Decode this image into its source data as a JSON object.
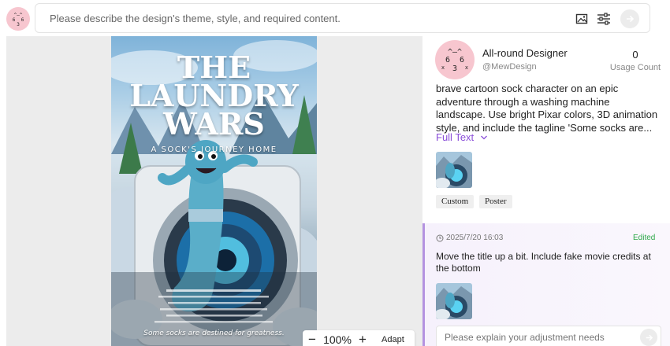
{
  "topbar": {
    "logo_icon": "cat-face-icon",
    "prompt_placeholder": "Please describe the design's theme, style, and required content.",
    "prompt_value": "",
    "icons": [
      "image-upload-icon",
      "settings-sliders-icon",
      "send-arrow-icon"
    ]
  },
  "poster": {
    "title_line1": "THE",
    "title_line2": "LAUNDRY",
    "title_line3": "WARS",
    "subtitle": "A SOCK'S JOURNEY HOME",
    "tagline": "Some socks are destined for greatness."
  },
  "zoom": {
    "minus": "−",
    "value": "100%",
    "plus": "+",
    "adapt_label": "Adapt"
  },
  "designer": {
    "name": "All-round Designer",
    "handle": "@MewDesign",
    "usage_count": "0",
    "usage_label": "Usage Count"
  },
  "request": {
    "description": "brave cartoon sock character on an epic adventure through a washing machine landscape. Use bright Pixar colors, 3D animation style, and include the tagline 'Some socks are...",
    "full_text_label": "Full Text",
    "tags": [
      "Custom",
      "Poster"
    ]
  },
  "history": {
    "timestamp": "2025/7/20 16:03",
    "status": "Edited",
    "text": "Move the title up a bit. Include fake movie credits at the bottom"
  },
  "adjust": {
    "placeholder": "Please explain your adjustment needs"
  },
  "colors": {
    "accent": "#8b4fd9",
    "edited": "#2ea84a",
    "history_border": "#b493e0"
  }
}
